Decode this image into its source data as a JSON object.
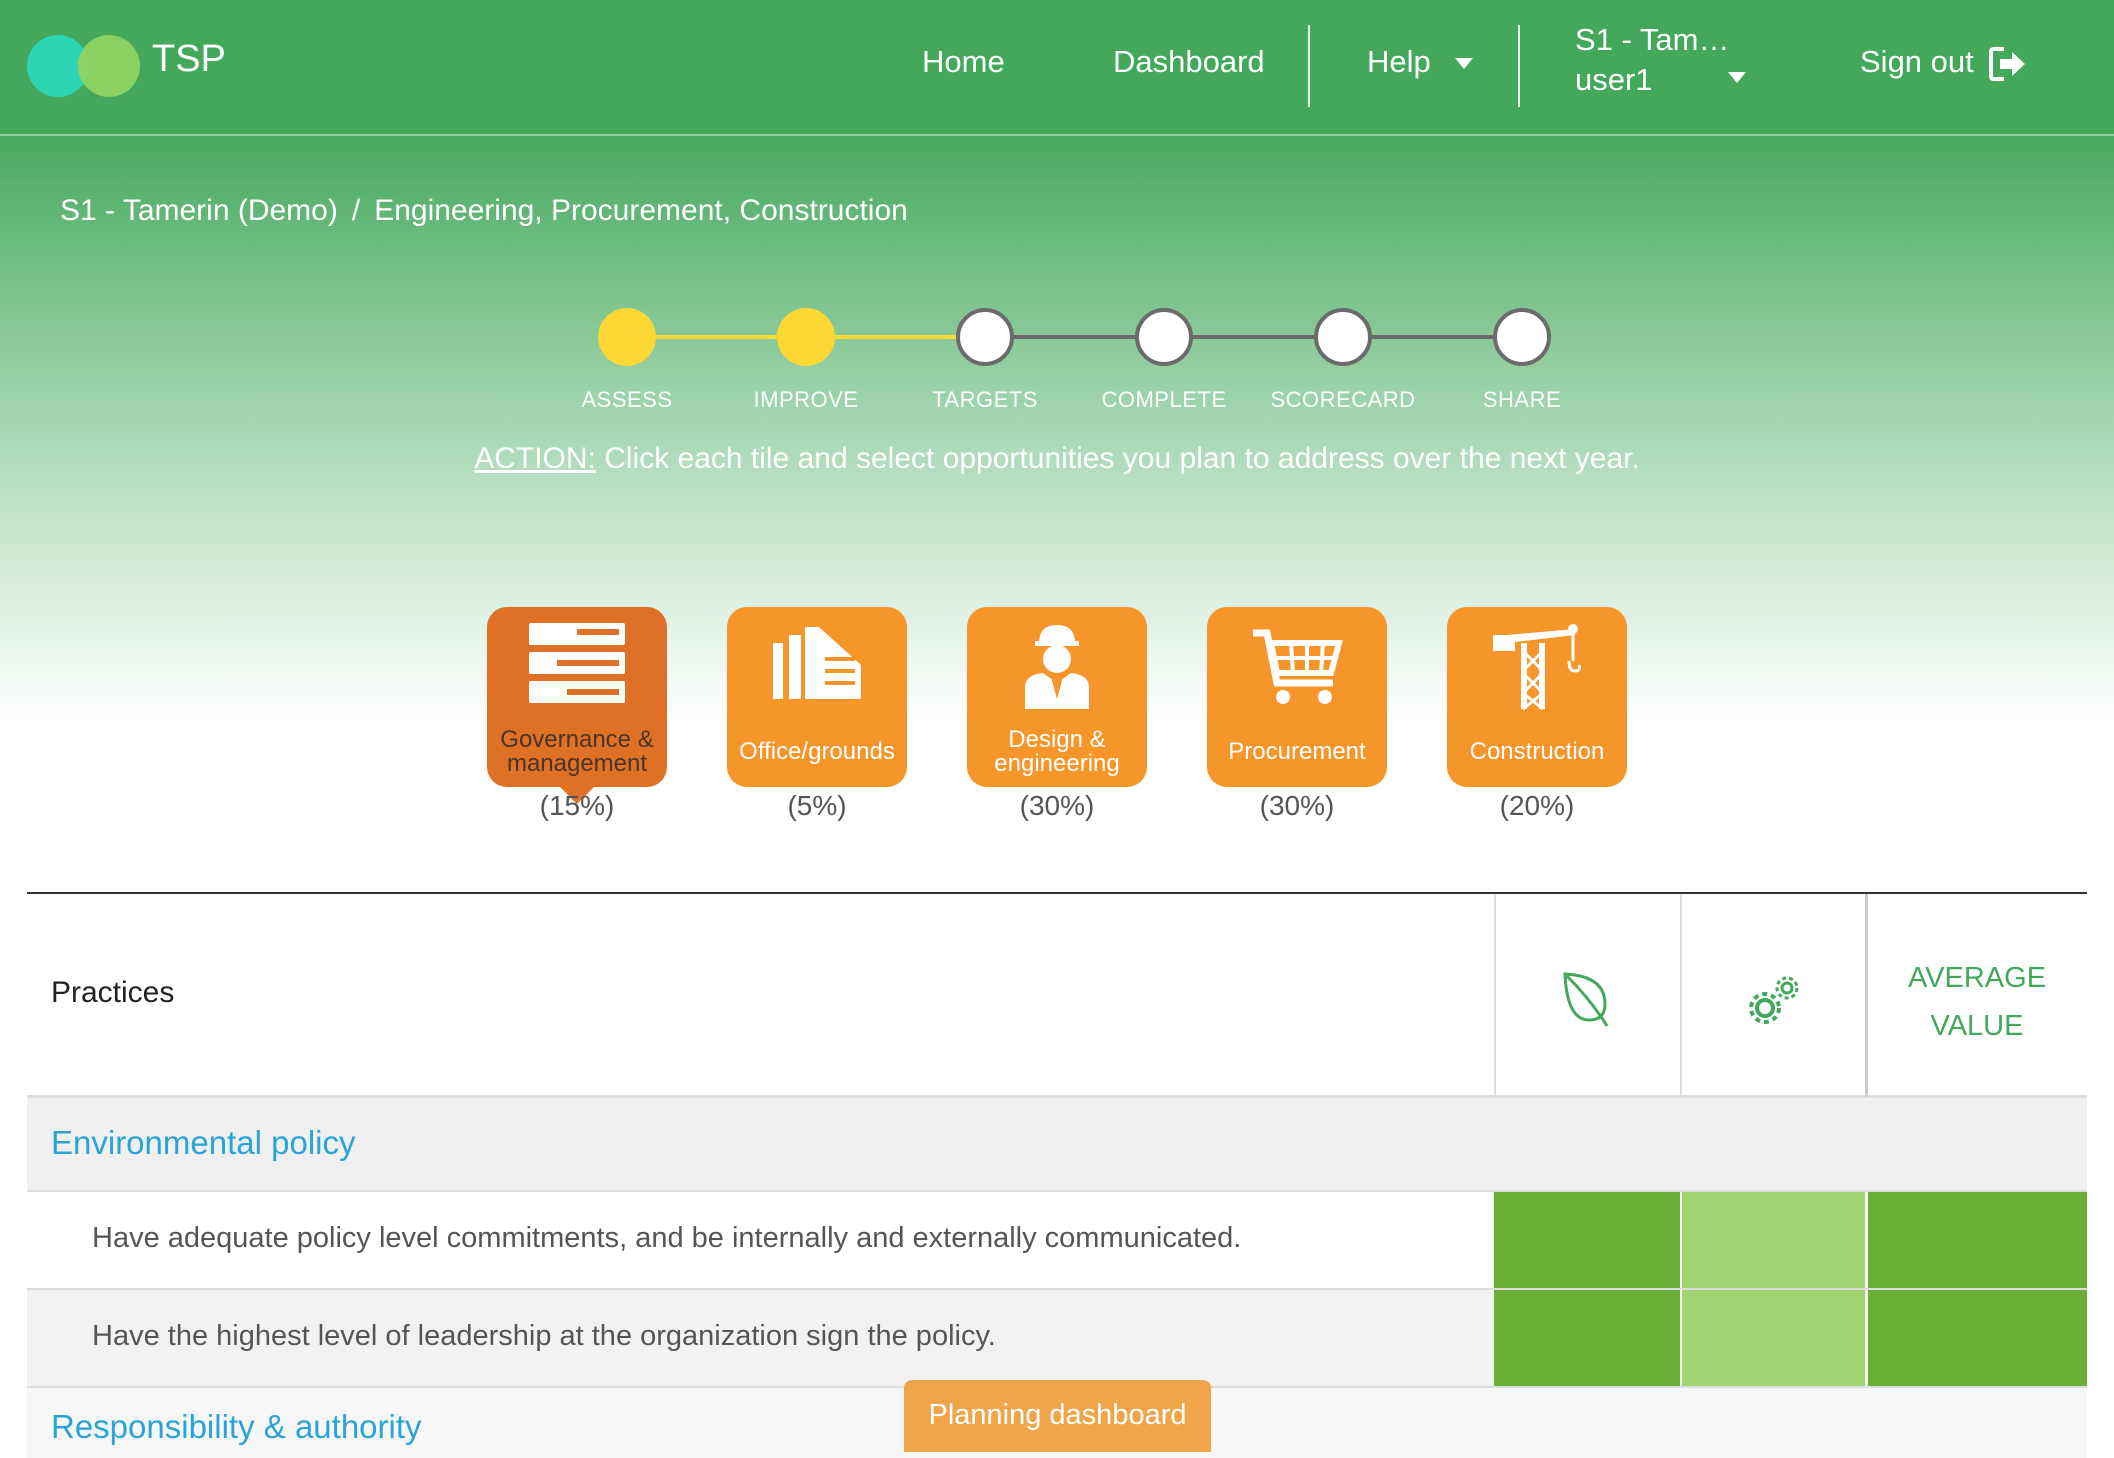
{
  "header": {
    "brand": "TSP",
    "nav": {
      "home": "Home",
      "dashboard": "Dashboard",
      "help": "Help",
      "user_org": "S1 - Tam…",
      "user_name": "user1",
      "signout": "Sign out"
    }
  },
  "breadcrumb": {
    "org": "S1 - Tamerin (Demo)",
    "separator": "/",
    "sector": "Engineering, Procurement, Construction"
  },
  "stepper": {
    "steps": [
      {
        "label": "ASSESS",
        "status": "done"
      },
      {
        "label": "IMPROVE",
        "status": "done"
      },
      {
        "label": "TARGETS",
        "status": "todo"
      },
      {
        "label": "COMPLETE",
        "status": "todo"
      },
      {
        "label": "SCORECARD",
        "status": "todo"
      },
      {
        "label": "SHARE",
        "status": "todo"
      }
    ]
  },
  "action": {
    "prefix": "ACTION:",
    "text": " Click each tile and select opportunities you plan to address over the next year."
  },
  "tiles": [
    {
      "label_line1": "Governance &",
      "label_line2": "management",
      "percent": "(15%)",
      "icon": "server-stack-icon",
      "active": true
    },
    {
      "label_line1": "Office/grounds",
      "label_line2": "",
      "percent": "(5%)",
      "icon": "buildings-icon",
      "active": false
    },
    {
      "label_line1": "Design &",
      "label_line2": "engineering",
      "percent": "(30%)",
      "icon": "engineer-icon",
      "active": false
    },
    {
      "label_line1": "Procurement",
      "label_line2": "",
      "percent": "(30%)",
      "icon": "shopping-cart-icon",
      "active": false
    },
    {
      "label_line1": "Construction",
      "label_line2": "",
      "percent": "(20%)",
      "icon": "crane-icon",
      "active": false
    }
  ],
  "table": {
    "header_practices": "Practices",
    "header_avg_line1": "AVERAGE",
    "header_avg_line2": "VALUE",
    "col_icons": [
      "leaf-icon",
      "gears-icon"
    ],
    "sections": [
      {
        "title": "Environmental policy",
        "rows": [
          {
            "text": "Have adequate policy level commitments, and be internally and externally communicated.",
            "colors": [
              "#6aae36",
              "#a0d572",
              "#6aae36"
            ]
          },
          {
            "text": "Have the highest level of leadership at the organization sign the policy.",
            "colors": [
              "#6aae36",
              "#a0d572",
              "#6aae36"
            ]
          }
        ]
      },
      {
        "title": "Responsibility & authority",
        "rows": []
      }
    ]
  },
  "planning_button": "Planning dashboard",
  "colors": {
    "header_green": "#43a85c",
    "step_done": "#fdd835",
    "tile_orange": "#f6952a",
    "tile_active": "#df7127",
    "link_blue": "#2aa3d6"
  }
}
